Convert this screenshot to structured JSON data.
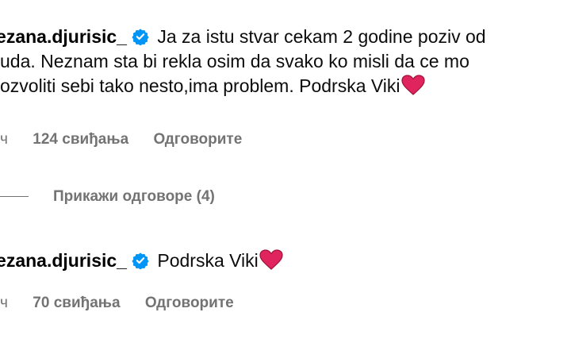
{
  "comments": [
    {
      "username": "nezana.djurisic_",
      "verified_icon": "verified-badge-icon",
      "lines": [
        "Ja za istu stvar cekam 2 godine poziv od",
        "uda. Neznam sta bi rekla osim da svako ko misli da ce mo",
        "ozvoliti sebi tako nesto,ima problem. Podrska Viki"
      ],
      "emoji": "red-heart-icon",
      "time": "ч",
      "likes": "124 свиђања",
      "reply_label": "Одговорите"
    },
    {
      "username": "nezana.djurisic_",
      "verified_icon": "verified-badge-icon",
      "text": "Podrska Viki",
      "emoji": "red-heart-icon",
      "time": "ч",
      "likes": "70 свиђања",
      "reply_label": "Одговорите"
    }
  ],
  "view_replies": {
    "label": "Прикажи одговоре (4)"
  },
  "colors": {
    "text": "#0c0c0c",
    "secondary": "#737373",
    "verified": "#0095f6",
    "heart": "#e0245e"
  }
}
